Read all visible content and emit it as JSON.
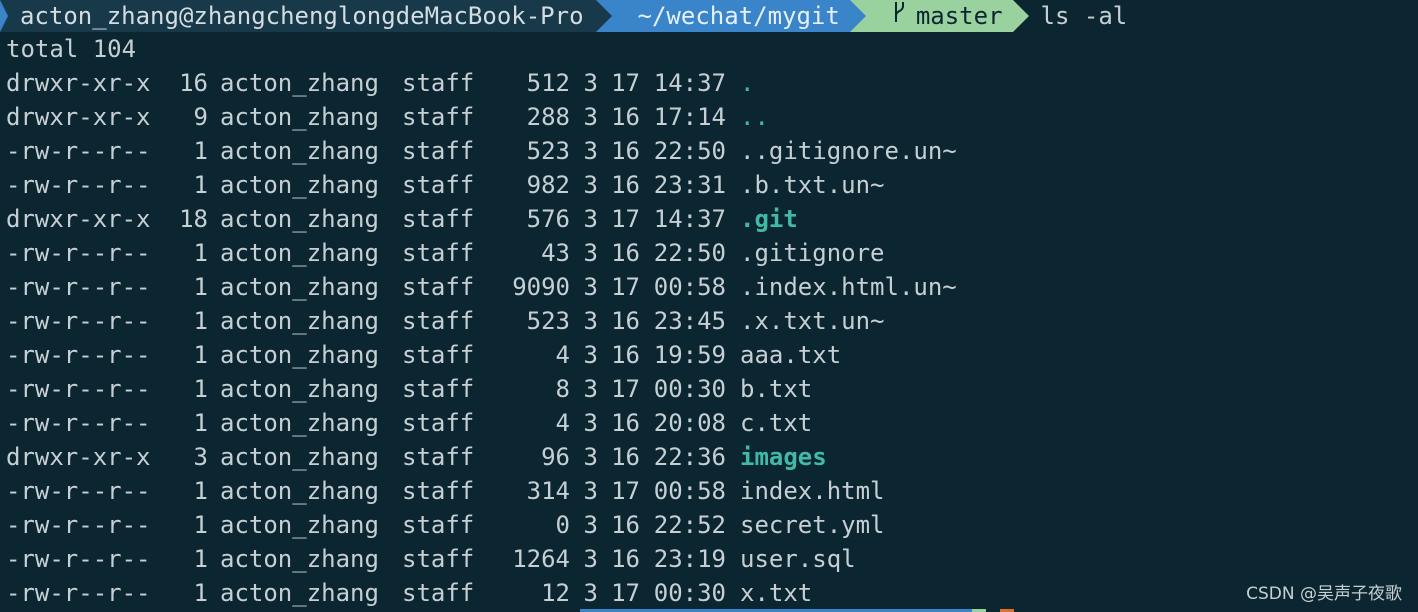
{
  "prompt": {
    "user_host": "acton_zhang@zhangchenglongdeMacBook-Pro",
    "path": "~/wechat/mygit",
    "branch_icon": "git-branch-icon",
    "branch": "master",
    "command": "ls -al"
  },
  "listing": {
    "total": "total 104",
    "entries": [
      {
        "perm": "drwxr-xr-x",
        "links": "16",
        "owner": "acton_zhang",
        "group": "staff",
        "size": "512",
        "mon": "3",
        "day": "17",
        "time": "14:37",
        "name": ".",
        "kind": "dot"
      },
      {
        "perm": "drwxr-xr-x",
        "links": "9",
        "owner": "acton_zhang",
        "group": "staff",
        "size": "288",
        "mon": "3",
        "day": "16",
        "time": "17:14",
        "name": "..",
        "kind": "dot"
      },
      {
        "perm": "-rw-r--r--",
        "links": "1",
        "owner": "acton_zhang",
        "group": "staff",
        "size": "523",
        "mon": "3",
        "day": "16",
        "time": "22:50",
        "name": "..gitignore.un~",
        "kind": "file"
      },
      {
        "perm": "-rw-r--r--",
        "links": "1",
        "owner": "acton_zhang",
        "group": "staff",
        "size": "982",
        "mon": "3",
        "day": "16",
        "time": "23:31",
        "name": ".b.txt.un~",
        "kind": "file"
      },
      {
        "perm": "drwxr-xr-x",
        "links": "18",
        "owner": "acton_zhang",
        "group": "staff",
        "size": "576",
        "mon": "3",
        "day": "17",
        "time": "14:37",
        "name": ".git",
        "kind": "dir"
      },
      {
        "perm": "-rw-r--r--",
        "links": "1",
        "owner": "acton_zhang",
        "group": "staff",
        "size": "43",
        "mon": "3",
        "day": "16",
        "time": "22:50",
        "name": ".gitignore",
        "kind": "file"
      },
      {
        "perm": "-rw-r--r--",
        "links": "1",
        "owner": "acton_zhang",
        "group": "staff",
        "size": "9090",
        "mon": "3",
        "day": "17",
        "time": "00:58",
        "name": ".index.html.un~",
        "kind": "file"
      },
      {
        "perm": "-rw-r--r--",
        "links": "1",
        "owner": "acton_zhang",
        "group": "staff",
        "size": "523",
        "mon": "3",
        "day": "16",
        "time": "23:45",
        "name": ".x.txt.un~",
        "kind": "file"
      },
      {
        "perm": "-rw-r--r--",
        "links": "1",
        "owner": "acton_zhang",
        "group": "staff",
        "size": "4",
        "mon": "3",
        "day": "16",
        "time": "19:59",
        "name": "aaa.txt",
        "kind": "file"
      },
      {
        "perm": "-rw-r--r--",
        "links": "1",
        "owner": "acton_zhang",
        "group": "staff",
        "size": "8",
        "mon": "3",
        "day": "17",
        "time": "00:30",
        "name": "b.txt",
        "kind": "file"
      },
      {
        "perm": "-rw-r--r--",
        "links": "1",
        "owner": "acton_zhang",
        "group": "staff",
        "size": "4",
        "mon": "3",
        "day": "16",
        "time": "20:08",
        "name": "c.txt",
        "kind": "file"
      },
      {
        "perm": "drwxr-xr-x",
        "links": "3",
        "owner": "acton_zhang",
        "group": "staff",
        "size": "96",
        "mon": "3",
        "day": "16",
        "time": "22:36",
        "name": "images",
        "kind": "dir"
      },
      {
        "perm": "-rw-r--r--",
        "links": "1",
        "owner": "acton_zhang",
        "group": "staff",
        "size": "314",
        "mon": "3",
        "day": "17",
        "time": "00:58",
        "name": "index.html",
        "kind": "file"
      },
      {
        "perm": "-rw-r--r--",
        "links": "1",
        "owner": "acton_zhang",
        "group": "staff",
        "size": "0",
        "mon": "3",
        "day": "16",
        "time": "22:52",
        "name": "secret.yml",
        "kind": "file"
      },
      {
        "perm": "-rw-r--r--",
        "links": "1",
        "owner": "acton_zhang",
        "group": "staff",
        "size": "1264",
        "mon": "3",
        "day": "16",
        "time": "23:19",
        "name": "user.sql",
        "kind": "file"
      },
      {
        "perm": "-rw-r--r--",
        "links": "1",
        "owner": "acton_zhang",
        "group": "staff",
        "size": "12",
        "mon": "3",
        "day": "17",
        "time": "00:30",
        "name": "x.txt",
        "kind": "file"
      }
    ]
  },
  "watermark": "CSDN @吴声子夜歌",
  "colors": {
    "background": "#0c2631",
    "user_segment": "#17394a",
    "path_segment": "#3a84c9",
    "git_segment": "#9ad29f",
    "directory": "#42b8a8",
    "text": "#c6d0d4"
  }
}
